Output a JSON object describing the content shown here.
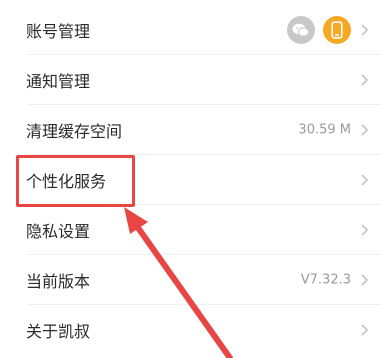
{
  "settings": {
    "items": [
      {
        "label": "账号管理",
        "value": "",
        "icons": [
          "wechat-icon",
          "phone-icon"
        ]
      },
      {
        "label": "通知管理",
        "value": ""
      },
      {
        "label": "清理缓存空间",
        "value": "30.59 M"
      },
      {
        "label": "个性化服务",
        "value": ""
      },
      {
        "label": "隐私设置",
        "value": ""
      },
      {
        "label": "当前版本",
        "value": "V7.32.3"
      },
      {
        "label": "关于凯叔",
        "value": ""
      }
    ]
  },
  "colors": {
    "accent_orange": "#F7A823",
    "wechat_gray": "#C8C8C8",
    "annotation_red": "#E84545",
    "chevron": "#BFBFBF",
    "text_primary": "#2A2A2A",
    "text_secondary": "#9A9A9A"
  },
  "annotation": {
    "highlighted_item": "个性化服务",
    "type": "red-box-with-arrow"
  }
}
